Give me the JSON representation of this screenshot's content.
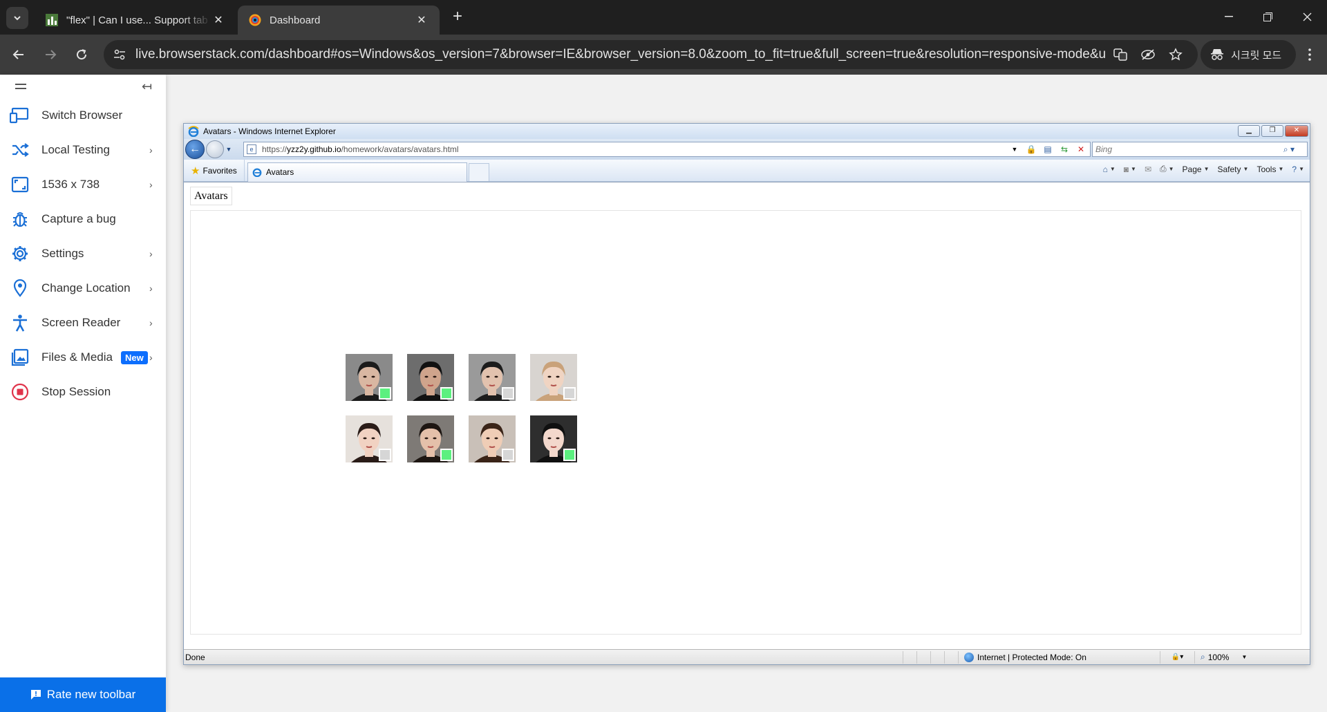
{
  "chrome": {
    "tabs": [
      {
        "title": "\"flex\" | Can I use... Support tab",
        "active": false
      },
      {
        "title": "Dashboard",
        "active": true
      }
    ],
    "url": "live.browserstack.com/dashboard#os=Windows&os_version=7&browser=IE&browser_version=8.0&zoom_to_fit=true&full_screen=true&resolution=responsive-mode&url=ht...",
    "incognito_label": "시크릿 모드"
  },
  "sidebar": {
    "items": [
      {
        "label": "Switch Browser",
        "icon": "devices-icon",
        "has_chevron": false
      },
      {
        "label": "Local Testing",
        "icon": "shuffle-icon",
        "has_chevron": true
      },
      {
        "label": "1536 x 738",
        "icon": "resolution-icon",
        "has_chevron": true
      },
      {
        "label": "Capture a bug",
        "icon": "bug-icon",
        "has_chevron": false
      },
      {
        "label": "Settings",
        "icon": "gear-icon",
        "has_chevron": true
      },
      {
        "label": "Change Location",
        "icon": "location-pin-icon",
        "has_chevron": true
      },
      {
        "label": "Screen Reader",
        "icon": "accessibility-icon",
        "has_chevron": true
      },
      {
        "label": "Files & Media",
        "icon": "image-icon",
        "has_chevron": true,
        "badge": "New"
      },
      {
        "label": "Stop Session",
        "icon": "stop-icon",
        "has_chevron": false
      }
    ],
    "rate_label": "Rate new toolbar",
    "accent": "#1a6fd6"
  },
  "ie": {
    "window_title": "Avatars - Windows Internet Explorer",
    "url_scheme": "https://",
    "url_host": "yzz2y.github.io",
    "url_path": "/homework/avatars/avatars.html",
    "search_placeholder": "Bing",
    "favorites_label": "Favorites",
    "tab_title": "Avatars",
    "commands": [
      "Page",
      "Safety",
      "Tools"
    ],
    "status_text": "Done",
    "zone_text": "Internet | Protected Mode: On",
    "zoom_text": "100%"
  },
  "page": {
    "caption": "Avatars",
    "avatars": [
      {
        "name": "avatar-1",
        "online": true,
        "skin": "#d9b7a2",
        "hair": "#1b1b1b",
        "bg": "#8a8a8a"
      },
      {
        "name": "avatar-2",
        "online": true,
        "skin": "#cfa48c",
        "hair": "#111111",
        "bg": "#6d6d6d"
      },
      {
        "name": "avatar-3",
        "online": false,
        "skin": "#e2c2ae",
        "hair": "#1c1c1c",
        "bg": "#9a9a9a"
      },
      {
        "name": "avatar-4",
        "online": false,
        "skin": "#f0d4c2",
        "hair": "#c9a27a",
        "bg": "#d8d4d0"
      },
      {
        "name": "avatar-5",
        "online": false,
        "skin": "#f1d2c2",
        "hair": "#2a1c18",
        "bg": "#e6e1dc"
      },
      {
        "name": "avatar-6",
        "online": true,
        "skin": "#e4c0aa",
        "hair": "#1d1612",
        "bg": "#7e7a76"
      },
      {
        "name": "avatar-7",
        "online": false,
        "skin": "#efcdb6",
        "hair": "#3a2418",
        "bg": "#c9c0b8"
      },
      {
        "name": "avatar-8",
        "online": true,
        "skin": "#f3d8cc",
        "hair": "#101010",
        "bg": "#2e2e2e"
      }
    ],
    "online_color": "#5cf07f",
    "offline_color": "#d6d6d6"
  }
}
